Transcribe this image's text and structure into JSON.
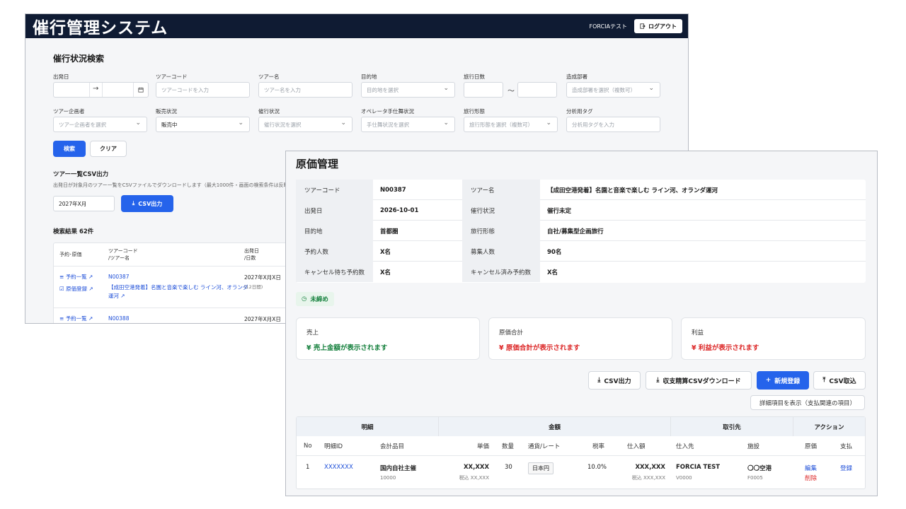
{
  "header": {
    "app_title": "催行管理システム",
    "user": "FORCIAテスト",
    "logout": "ログアウト"
  },
  "search": {
    "title": "催行状況検索",
    "fields": {
      "departure": {
        "label": "出発日",
        "sep": "→"
      },
      "tour_code": {
        "label": "ツアーコード",
        "placeholder": "ツアーコードを入力"
      },
      "tour_name": {
        "label": "ツアー名",
        "placeholder": "ツアー名を入力"
      },
      "destination": {
        "label": "目的地",
        "placeholder": "目的地を選択"
      },
      "days": {
        "label": "旅行日数",
        "sep": "〜"
      },
      "dept": {
        "label": "造成部署",
        "placeholder": "造成部署を選択（複数可）"
      },
      "planner": {
        "label": "ツアー企画者",
        "placeholder": "ツアー企画者を選択"
      },
      "sales": {
        "label": "販売状況",
        "value": "販売中"
      },
      "status": {
        "label": "催行状況",
        "placeholder": "催行状況を選択"
      },
      "operator": {
        "label": "オペレータ手仕舞状況",
        "placeholder": "手仕舞状況を選択"
      },
      "form": {
        "label": "旅行形態",
        "placeholder": "旅行形態を選択（複数可）"
      },
      "tag": {
        "label": "分析用タグ",
        "placeholder": "分析用タグを入力"
      }
    },
    "search_btn": "検索",
    "clear_btn": "クリア"
  },
  "csv": {
    "title": "ツアー一覧CSV出力",
    "desc": "出発日が対象月のツアー一覧をCSVファイルでダウンロードします（最大1000件・画面の検索条件は反映さ",
    "month": "2027年X月",
    "btn": "CSV出力"
  },
  "results": {
    "count": "検索結果 62件",
    "headers": {
      "a": "予約･原価",
      "b1": "ツアーコード",
      "b2": "/ツアー名",
      "c1": "出発日",
      "c2": "/日数"
    },
    "rows": [
      {
        "link1": "予約一覧 ↗",
        "link2": "原価登録 ↗",
        "code": "N00387",
        "name1": "【成田空港発着】名園と音楽で楽しむ ライン河、オランダ",
        "name2": "運河 ↗",
        "date": "2027年X月X日",
        "days": "(12日間)"
      },
      {
        "link1": "予約一覧 ↗",
        "code": "N00388",
        "date": "2027年X月X日"
      }
    ]
  },
  "cost": {
    "title": "原価管理",
    "info": {
      "tour_code_label": "ツアーコード",
      "tour_code": "N00387",
      "tour_name_label": "ツアー名",
      "tour_name": "【成田空港発着】名園と音楽で楽しむ ライン河、オランダ運河",
      "dep_label": "出発日",
      "dep": "2026-10-01",
      "status_label": "催行状況",
      "status": "催行未定",
      "dest_label": "目的地",
      "dest": "首都圏",
      "form_label": "旅行形態",
      "form": "自社/募集型企画旅行",
      "res_label": "予約人数",
      "res": "X名",
      "recruit_label": "募集人数",
      "recruit": "90名",
      "wait_label": "キャンセル待ち予約数",
      "wait": "X名",
      "canceled_label": "キャンセル済み予約数",
      "canceled": "X名"
    },
    "badge": "未締め",
    "cards": {
      "sales_label": "売上",
      "sales_val": "¥ 売上金額が表示されます",
      "cost_label": "原価合計",
      "cost_val": "¥ 原価合計が表示されます",
      "profit_label": "利益",
      "profit_val": "¥ 利益が表示されます"
    },
    "buttons": {
      "csv_out": "CSV出力",
      "settle": "収支精算CSVダウンロード",
      "new": "新規登録",
      "csv_in": "CSV取込"
    },
    "detail_toggle": "詳細項目を表示（支払関連の項目）",
    "table": {
      "groups": [
        "明細",
        "金額",
        "取引先",
        "アクション"
      ],
      "cols": [
        "No",
        "明細ID",
        "会計品目",
        "単価",
        "数量",
        "通貨/レート",
        "税率",
        "仕入額",
        "仕入先",
        "施設",
        "原価",
        "支払"
      ],
      "row": {
        "no": "1",
        "id": "XXXXXXX",
        "item": "国内自社主催",
        "item_code": "10000",
        "unit": "XX,XXX",
        "unit_tax": "税込 XX,XXX",
        "qty": "30",
        "currency": "日本円",
        "tax": "10.0%",
        "amount": "XXX,XXX",
        "amount_tax": "税込 XXX,XXX",
        "vendor": "FORCIA TEST",
        "vendor_code": "V0000",
        "facility": "〇〇空港",
        "facility_code": "F0005",
        "edit": "編集",
        "delete": "削除",
        "pay": "登録"
      }
    }
  }
}
